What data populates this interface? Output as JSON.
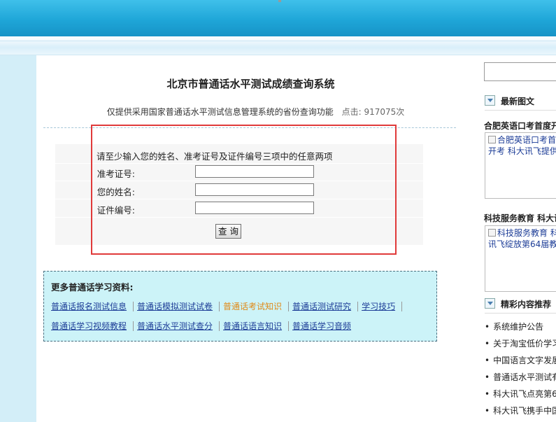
{
  "page": {
    "title": "北京市普通话水平测试成绩查询系统",
    "subtitle": "仅提供采用国家普通话水平测试信息管理系统的省份查询功能",
    "hits_label": "点击:",
    "hits_count": "917075次"
  },
  "form": {
    "instruction": "请至少输入您的姓名、准考证号及证件编号三项中的任意两项",
    "fields": [
      {
        "label": "准考证号:",
        "value": ""
      },
      {
        "label": "您的姓名:",
        "value": ""
      },
      {
        "label": "证件编号:",
        "value": ""
      }
    ],
    "submit_label": "查 询"
  },
  "more_resources": {
    "heading": "更多普通话学习资料:",
    "row1": [
      "普通话报名测试信息",
      "普通话模拟测试试卷",
      "普通话考试知识",
      "普通话测试研究",
      "学习技巧"
    ],
    "row2": [
      "普通话学习视频教程",
      "普通话水平测试查分",
      "普通话语言知识",
      "普通话学习音频"
    ]
  },
  "sidebar": {
    "search_value": "",
    "latest_heading": "最新图文",
    "item1_title": "合肥英语口考首度开",
    "item1_caption_line1": "合肥英语口考首",
    "item1_caption_line2": "开考 科大讯飞提供",
    "item2_title": "科技服务教育 科大讯",
    "item2_caption_line1": "科技服务教育 科",
    "item2_caption_line2": "讯飞绽放第64届教",
    "featured_heading": "精彩内容推荐",
    "featured_items": [
      "系统维护公告",
      "关于淘宝低价学习",
      "中国语言文字发展",
      "普通话水平测试有",
      "科大讯飞点亮第6",
      "科大讯飞携手中国"
    ]
  },
  "colors": {
    "header_blue": "#1fa6d8",
    "left_column": "#d3eef8",
    "info_box": "#ccf3f8",
    "highlight_red": "#e03a3a",
    "link_blue": "#1d3d97",
    "link_orange": "#e08a18"
  }
}
